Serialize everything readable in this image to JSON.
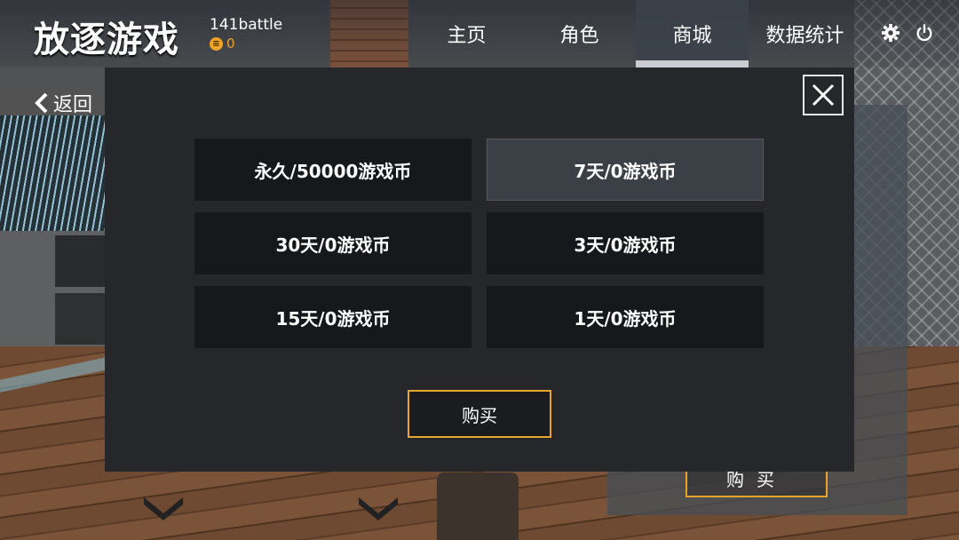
{
  "app": {
    "title": "放逐游戏"
  },
  "user": {
    "name": "141battle",
    "coin_icon_glyph": "≡",
    "coins": "0",
    "coin_color": "#f0a324"
  },
  "nav": {
    "tabs": [
      {
        "label": "主页",
        "active": false
      },
      {
        "label": "角色",
        "active": false
      },
      {
        "label": "商城",
        "active": true
      },
      {
        "label": "数据统计",
        "active": false
      }
    ],
    "icons": [
      "settings-icon",
      "power-icon"
    ]
  },
  "back": {
    "label": "返回"
  },
  "dialog": {
    "options": [
      {
        "label": "永久/50000游戏币",
        "selected": false
      },
      {
        "label": "7天/0游戏币",
        "selected": true
      },
      {
        "label": "30天/0游戏币",
        "selected": false
      },
      {
        "label": "3天/0游戏币",
        "selected": false
      },
      {
        "label": "15天/0游戏币",
        "selected": false
      },
      {
        "label": "1天/0游戏币",
        "selected": false
      }
    ],
    "buy_label": "购买",
    "accent_color": "#e8a52c"
  },
  "background": {
    "buy_label": "购买"
  }
}
